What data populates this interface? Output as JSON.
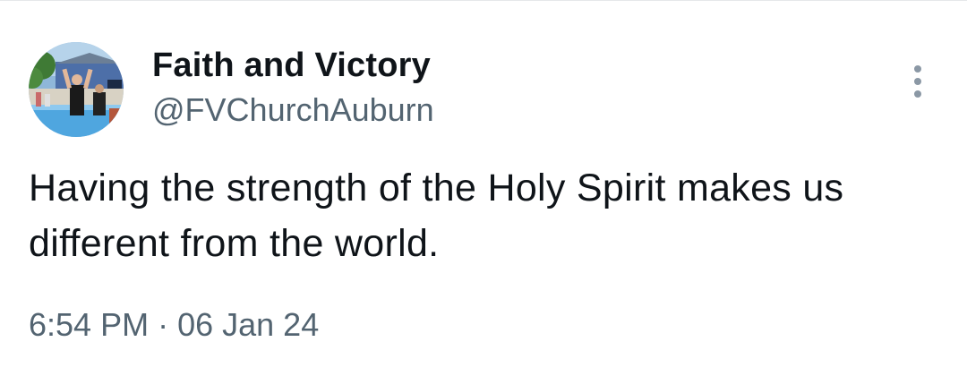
{
  "user": {
    "display_name": "Faith and Victory",
    "handle": "@FVChurchAuburn",
    "avatar_icon": "profile-photo-baptism"
  },
  "tweet": {
    "text": "Having the strength of the Holy Spirit makes us different from the world."
  },
  "meta": {
    "time": "6:54 PM",
    "separator": "·",
    "date": "06 Jan 24"
  },
  "menu": {
    "icon": "more-vertical-icon"
  },
  "colors": {
    "text_primary": "#0f1419",
    "text_secondary": "#536471",
    "divider": "#e6e8ea",
    "menu_dots": "#8b98a5"
  }
}
